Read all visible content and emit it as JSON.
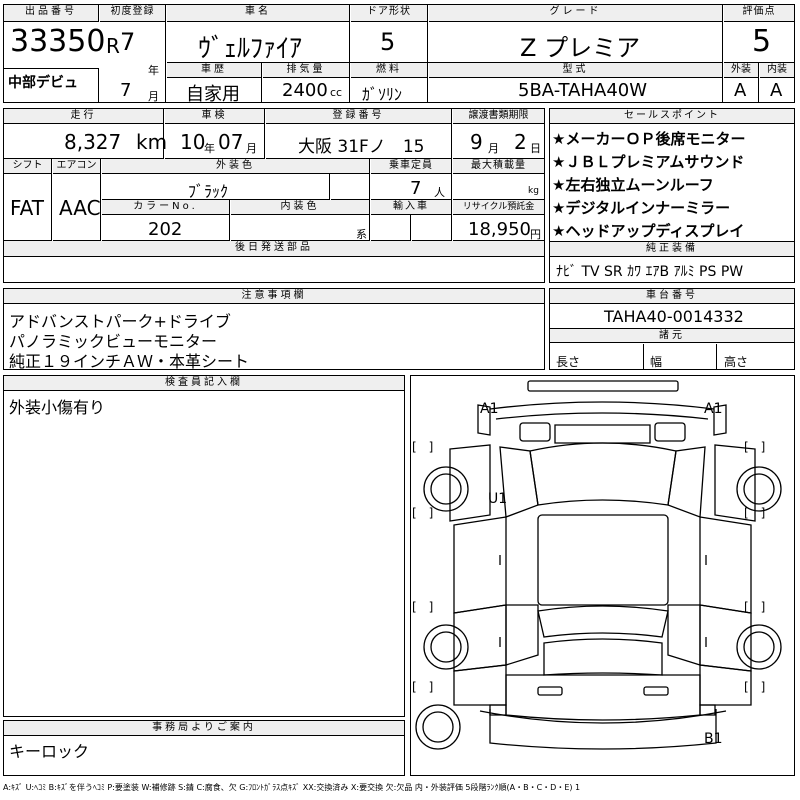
{
  "header": {
    "lot_no_label": "出品番号",
    "lot_no": "33350",
    "debut": "中部デビュ",
    "first_reg_label": "初度登録",
    "era": "R",
    "year_val": "7",
    "year_unit": "年",
    "month_val": "7",
    "month_unit": "月",
    "car_name_label": "車名",
    "car_name": "ｳﾞｪﾙﾌｧｲｱ",
    "door_label": "ドア形状",
    "door": "5",
    "grade_label": "グレード",
    "grade": "Z プレミア",
    "score_label": "評価点",
    "score": "5",
    "history_label": "車歴",
    "history": "自家用",
    "displacement_label": "排気量",
    "displacement": "2400",
    "displacement_unit": "cc",
    "fuel_label": "燃料",
    "fuel": "ｶﾞｿﾘﾝ",
    "model_label": "型式",
    "model": "5BA-TAHA40W",
    "ext_label": "外装",
    "int_label": "内装",
    "ext_score": "A",
    "int_score": "A"
  },
  "row2": {
    "mileage_label": "走行",
    "mileage": "8,327",
    "mileage_unit": "km",
    "inspection_label": "車検",
    "insp_year": "10",
    "insp_year_unit": "年",
    "insp_month": "07",
    "insp_month_unit": "月",
    "plate_label": "登録番号",
    "plate": "大阪 31Fノ　15",
    "transfer_label": "譲渡書類期限",
    "transfer_month": "9",
    "transfer_month_unit": "月",
    "transfer_day": "2",
    "transfer_day_unit": "日",
    "shift_label": "シフト",
    "shift": "FAT",
    "ac_label": "エアコン",
    "ac": "AAC",
    "ext_color_label": "外装色",
    "ext_color": "ﾌﾞﾗｯｸ",
    "capacity_label": "乗車定員",
    "capacity": "7",
    "capacity_unit": "人",
    "max_load_label": "最大積載量",
    "max_load_unit": "kg",
    "color_no_label": "カラーNo.",
    "color_no": "202",
    "int_color_label": "内装色",
    "int_color_unit": "系",
    "import_label": "輸入車",
    "recycle_label": "リサイクル預託金",
    "recycle": "18,950",
    "recycle_unit": "円",
    "later_parts_label": "後日発送部品"
  },
  "sales": {
    "label": "セールスポイント",
    "points": [
      "★メーカーＯＰ後席モニター",
      "★ＪＢＬプレミアムサウンド",
      "★左右独立ムーンルーフ",
      "★デジタルインナーミラー",
      "★ヘッドアップディスプレイ"
    ]
  },
  "equipment": {
    "label": "純正装備",
    "items": "ﾅﾋﾞ TV SR ｶﾜ ｴｱB ｱﾙﾐ PS PW"
  },
  "notes": {
    "label": "注意事項欄",
    "lines": [
      "アドバンストパーク+ドライブ",
      "パノラミックビューモニター",
      "純正１９インチＡＷ・本革シート"
    ]
  },
  "chassis": {
    "label": "車台番号",
    "value": "TAHA40-0014332",
    "specs_label": "諸元",
    "length_label": "長さ",
    "width_label": "幅",
    "height_label": "高さ"
  },
  "inspector": {
    "label": "検査員記入欄",
    "text": "外装小傷有り"
  },
  "office": {
    "label": "事務局よりご案内",
    "text": "キーロック"
  },
  "diagram": {
    "marks": [
      "A1",
      "A1",
      "U1",
      "B1"
    ],
    "bracket": "[　]"
  },
  "legend": "A:ｷｽﾞ U:ﾍｺﾐ B:ｷｽﾞを伴うﾍｺﾐ P:要塗装 W:補修跡 S:錆 C:腐食、欠 G:ﾌﾛﾝﾄｶﾞﾗｽ点ｷｽﾞ XX:交換済み X:要交換 欠:欠品 内・外装評価 5段階ﾗﾝｸ順(A・B・C・D・E) 1"
}
